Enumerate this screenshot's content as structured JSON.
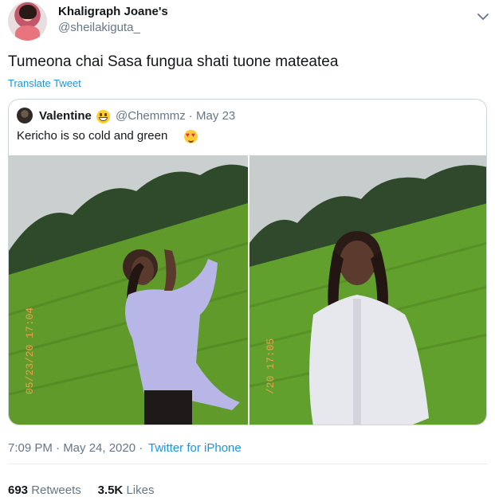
{
  "author": {
    "display_name": "Khaligraph Joane's",
    "handle": "@sheilakiguta_"
  },
  "tweet": {
    "text": "Tumeona chai Sasa fungua shati tuone mateatea",
    "translate_label": "Translate Tweet"
  },
  "quoted_tweet": {
    "display_name": "Valentine",
    "handle_date": "@Chemmmz · May 23",
    "text": "Kericho is so cold and green",
    "photos": [
      {
        "icon": "photo-woman-tea-field-1",
        "timestamp_overlay": "05/23/20 17:04"
      },
      {
        "icon": "photo-woman-tea-field-2",
        "timestamp_overlay": "/20 17:05"
      }
    ]
  },
  "meta": {
    "timestamp": "7:09 PM · May 24, 2020 ·",
    "source": "Twitter for iPhone"
  },
  "stats": {
    "retweets_count": "693",
    "retweets_label": "Retweets",
    "likes_count": "3.5K",
    "likes_label": "Likes"
  },
  "icons": {
    "menu": "chevron-down-icon",
    "emoji_name": "grinning-face-icon",
    "emoji_text": "heart-eyes-icon"
  },
  "colors": {
    "link": "#1b95e0",
    "secondary_text": "#657786",
    "border": "#ccd6dd",
    "tea_green": "#5f9a2a"
  }
}
